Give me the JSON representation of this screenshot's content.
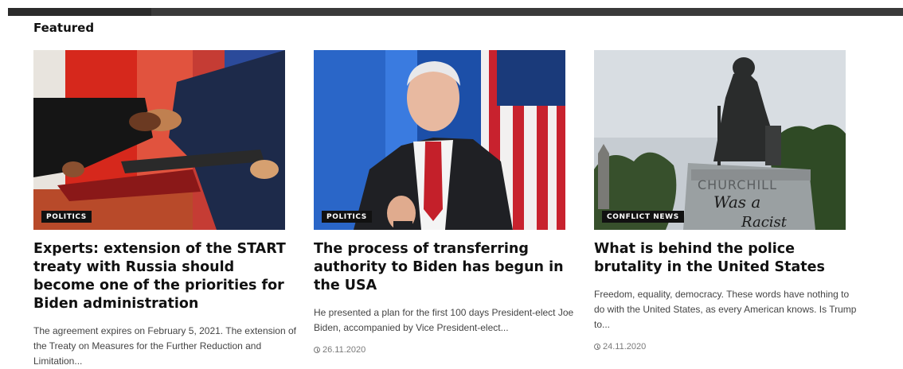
{
  "section": {
    "title": "Featured"
  },
  "articles": [
    {
      "category": "POLITICS",
      "title": "Experts: extension of the START treaty with Russia should become one of the priorities for Biden administration",
      "excerpt": "The agreement expires on February 5, 2021. The extension of the Treaty on Measures for the Further Reduction and Limitation...",
      "date": "",
      "image_icon": "handshake-photo"
    },
    {
      "category": "POLITICS",
      "title": "The process of transferring authority to Biden has begun in the USA",
      "excerpt": "He presented a plan for the first 100 days President-elect Joe Biden, accompanied by Vice President-elect...",
      "date": "26.11.2020",
      "image_icon": "speaker-photo"
    },
    {
      "category": "CONFLICT NEWS",
      "title": "What is behind the police brutality in the United States",
      "excerpt": "Freedom, equality, democracy. These words have nothing to do with the United States, as every American knows. Is Trump to...",
      "date": "24.11.2020",
      "image_icon": "statue-photo"
    }
  ],
  "image_text": {
    "statue_plinth": "CHURCHILL",
    "graffiti_line1": "Was a",
    "graffiti_line2": "Racist"
  },
  "colors": {
    "badge_bg": "#111111",
    "badge_text": "#ffffff",
    "topbar": "#2b2b2b"
  }
}
